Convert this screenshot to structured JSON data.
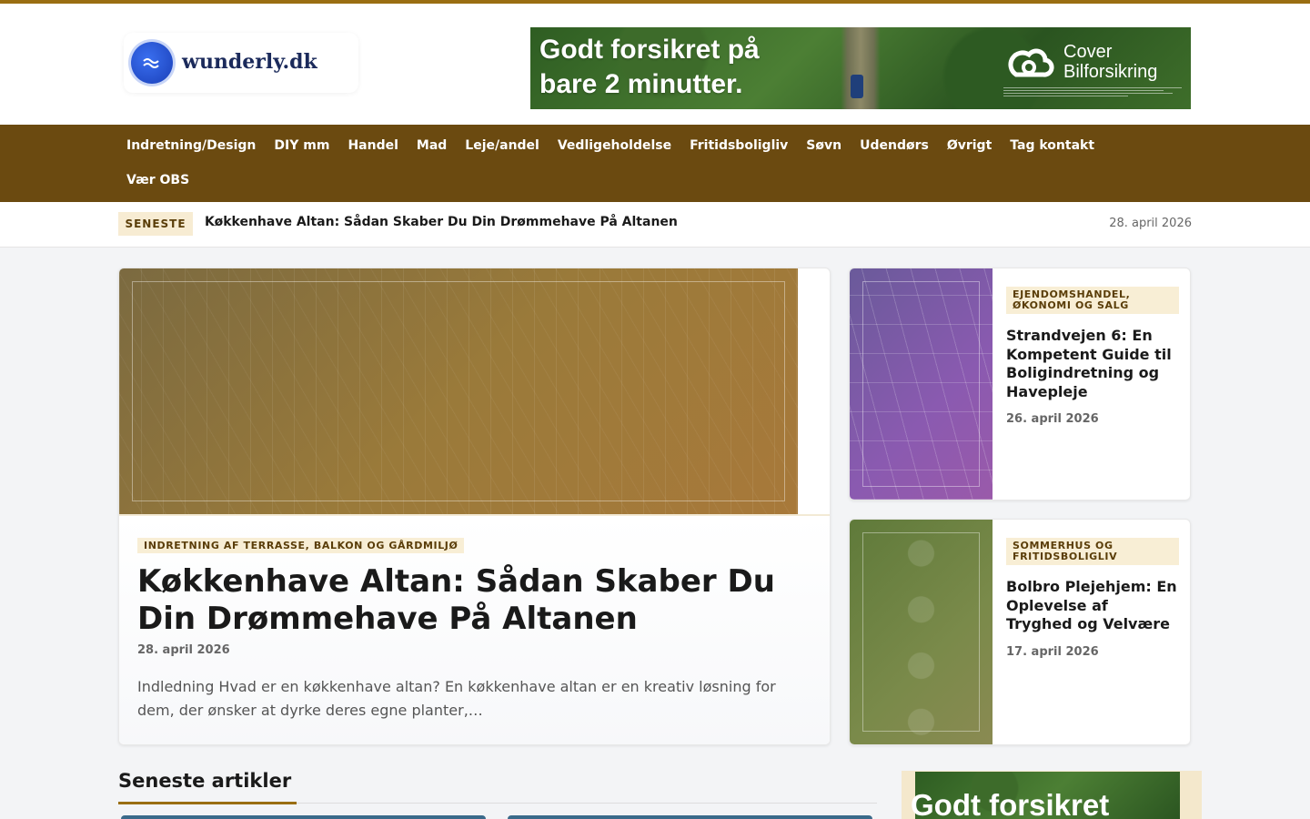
{
  "site": {
    "logo_text": "wunderly.dk"
  },
  "ad": {
    "headline": "Godt forsikret på bare 2 minutter.",
    "brand_line1": "Cover",
    "brand_line2": "Bilforsikring",
    "sidebar_headline": "Godt forsikret"
  },
  "nav": {
    "items": [
      {
        "label": "Indretning/Design"
      },
      {
        "label": "DIY mm"
      },
      {
        "label": "Handel"
      },
      {
        "label": "Mad"
      },
      {
        "label": "Leje/andel"
      },
      {
        "label": "Vedligeholdelse"
      },
      {
        "label": "Fritidsboligliv"
      },
      {
        "label": "Søvn"
      },
      {
        "label": "Udendørs"
      },
      {
        "label": "Øvrigt"
      },
      {
        "label": "Tag kontakt"
      },
      {
        "label": "Vær OBS"
      }
    ]
  },
  "ticker": {
    "badge": "SENESTE",
    "title": "Køkkenhave Altan: Sådan Skaber Du Din Drømmehave På Altanen",
    "date": "28. april 2026"
  },
  "hero": {
    "category": "INDRETNING AF TERRASSE, BALKON OG GÅRDMILJØ",
    "title": "Køkkenhave Altan: Sådan Skaber Du Din Drømmehave På Altanen",
    "date": "28. april 2026",
    "excerpt": "Indledning Hvad er en køkkenhave altan? En køkkenhave altan er en kreativ løsning for dem, der ønsker at dyrke deres egne planter,…"
  },
  "side_articles": [
    {
      "category": "EJENDOMSHANDEL, ØKONOMI OG SALG",
      "title": "Strandvejen 6: En Kompetent Guide til Boligindretning og Havepleje",
      "date": "26. april 2026"
    },
    {
      "category": "SOMMERHUS OG FRITIDSBOLIGLIV",
      "title": "Bolbro Plejehjem: En Oplevelse af Tryghed og Velvære",
      "date": "17. april 2026"
    }
  ],
  "latest": {
    "heading": "Seneste artikler"
  },
  "colors": {
    "accent": "#9a6e12",
    "nav_bg": "#6b4a10",
    "tag_bg": "#f8eed5"
  }
}
